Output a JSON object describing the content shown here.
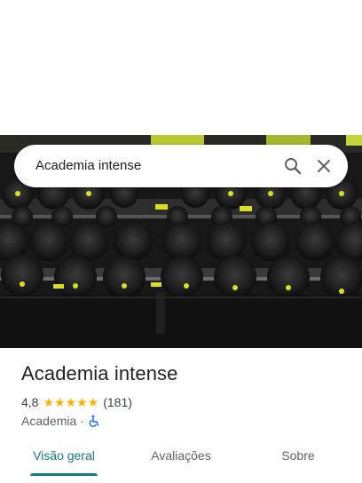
{
  "search": {
    "query": "Academia intense"
  },
  "place": {
    "name": "Academia intense",
    "rating": "4,8",
    "stars": "★★★★★",
    "reviews": "(181)",
    "category": "Academia",
    "separator": "·"
  },
  "tabs": [
    {
      "label": "Visão geral",
      "active": true
    },
    {
      "label": "Avaliações",
      "active": false
    },
    {
      "label": "Sobre",
      "active": false
    }
  ],
  "colors": {
    "accent": "#137a7f",
    "star": "#f6b400",
    "accessible": "#1a73e8"
  },
  "icons": {
    "search": "search-icon",
    "close": "close-icon",
    "accessibility": "wheelchair-icon"
  }
}
